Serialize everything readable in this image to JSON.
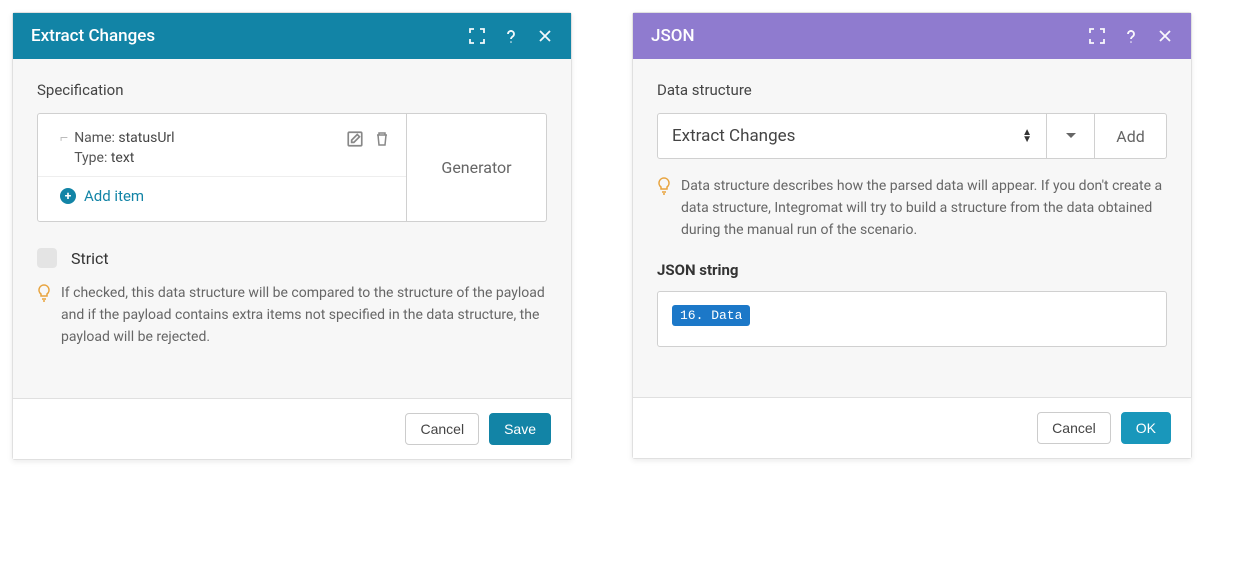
{
  "left": {
    "title": "Extract Changes",
    "section_label": "Specification",
    "spec": {
      "name_key": "Name:",
      "name_val": "statusUrl",
      "type_key": "Type:",
      "type_val": "text"
    },
    "add_item": "Add item",
    "generator": "Generator",
    "strict_label": "Strict",
    "hint": "If checked, this data structure will be compared to the structure of the payload and if the payload contains extra items not specified in the data structure, the payload will be rejected.",
    "cancel": "Cancel",
    "save": "Save"
  },
  "right": {
    "title": "JSON",
    "section_label": "Data structure",
    "select_value": "Extract Changes",
    "add": "Add",
    "hint": "Data structure describes how the parsed data will appear. If you don't create a data structure, Integromat will try to build a structure from the data obtained during the manual run of the scenario.",
    "json_label": "JSON string",
    "pill": "16. Data",
    "cancel": "Cancel",
    "ok": "OK"
  }
}
